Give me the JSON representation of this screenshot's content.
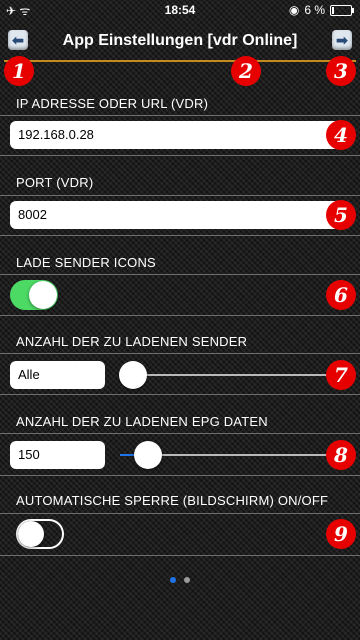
{
  "status_bar": {
    "time": "18:54",
    "battery_text": "6 %",
    "battery_level": 0.06
  },
  "nav": {
    "title": "App Einstellungen [vdr Online]",
    "back_icon": "arrow-left-icon",
    "forward_icon": "arrow-right-icon"
  },
  "markers": [
    "1",
    "2",
    "3",
    "4",
    "5",
    "6",
    "7",
    "8",
    "9"
  ],
  "sections": {
    "ip": {
      "header": "IP ADRESSE ODER URL (VDR)",
      "value": "192.168.0.28"
    },
    "port": {
      "header": "PORT (VDR)",
      "value": "8002"
    },
    "icons": {
      "header": "LADE SENDER ICONS",
      "on": true
    },
    "sender": {
      "header": "ANZAHL DER ZU LADENEN SENDER",
      "value": "Alle",
      "slider_level": 0
    },
    "epg": {
      "header": "ANZAHL DER ZU LADENEN EPG DATEN",
      "value": "150",
      "slider_level": 0.12
    },
    "lock": {
      "header": "AUTOMATISCHE SPERRE (BILDSCHIRM) ON/OFF",
      "on": false
    }
  },
  "page_indicator": {
    "count": 2,
    "current": 1
  },
  "colors": {
    "marker_red": "#e60000",
    "toggle_on": "#4cd964",
    "slider_fill": "#1e74e8",
    "nav_line": "#c58a1e"
  }
}
